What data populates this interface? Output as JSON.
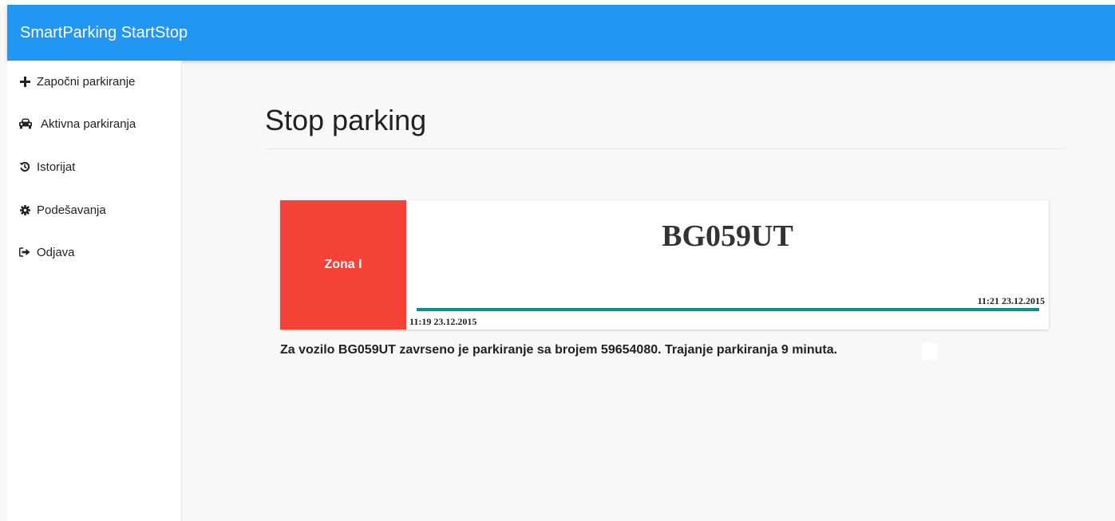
{
  "app": {
    "title": "SmartParking StartStop"
  },
  "sidebar": {
    "items": [
      {
        "label": "Započni parkiranje",
        "icon": "plus-icon"
      },
      {
        "label": "Aktivna parkiranja",
        "icon": "car-icon"
      },
      {
        "label": "Istorijat",
        "icon": "history-icon"
      },
      {
        "label": "Podešavanja",
        "icon": "gear-icon"
      },
      {
        "label": "Odjava",
        "icon": "sign-out-icon"
      }
    ]
  },
  "main": {
    "title": "Stop parking"
  },
  "parking_card": {
    "zone": "Zona I",
    "zone_color": "#f44336",
    "plate": "BG059UT",
    "start_time": "11:19 23.12.2015",
    "end_time": "11:21 23.12.2015",
    "progress_percent": 100,
    "progress_color": "#009688"
  },
  "status_message": "Za vozilo BG059UT zavrseno je parkiranje sa brojem 59654080. Trajanje parkiranja 9 minuta.",
  "colors": {
    "appbar": "#2196f3",
    "background": "#f8f8f8"
  }
}
